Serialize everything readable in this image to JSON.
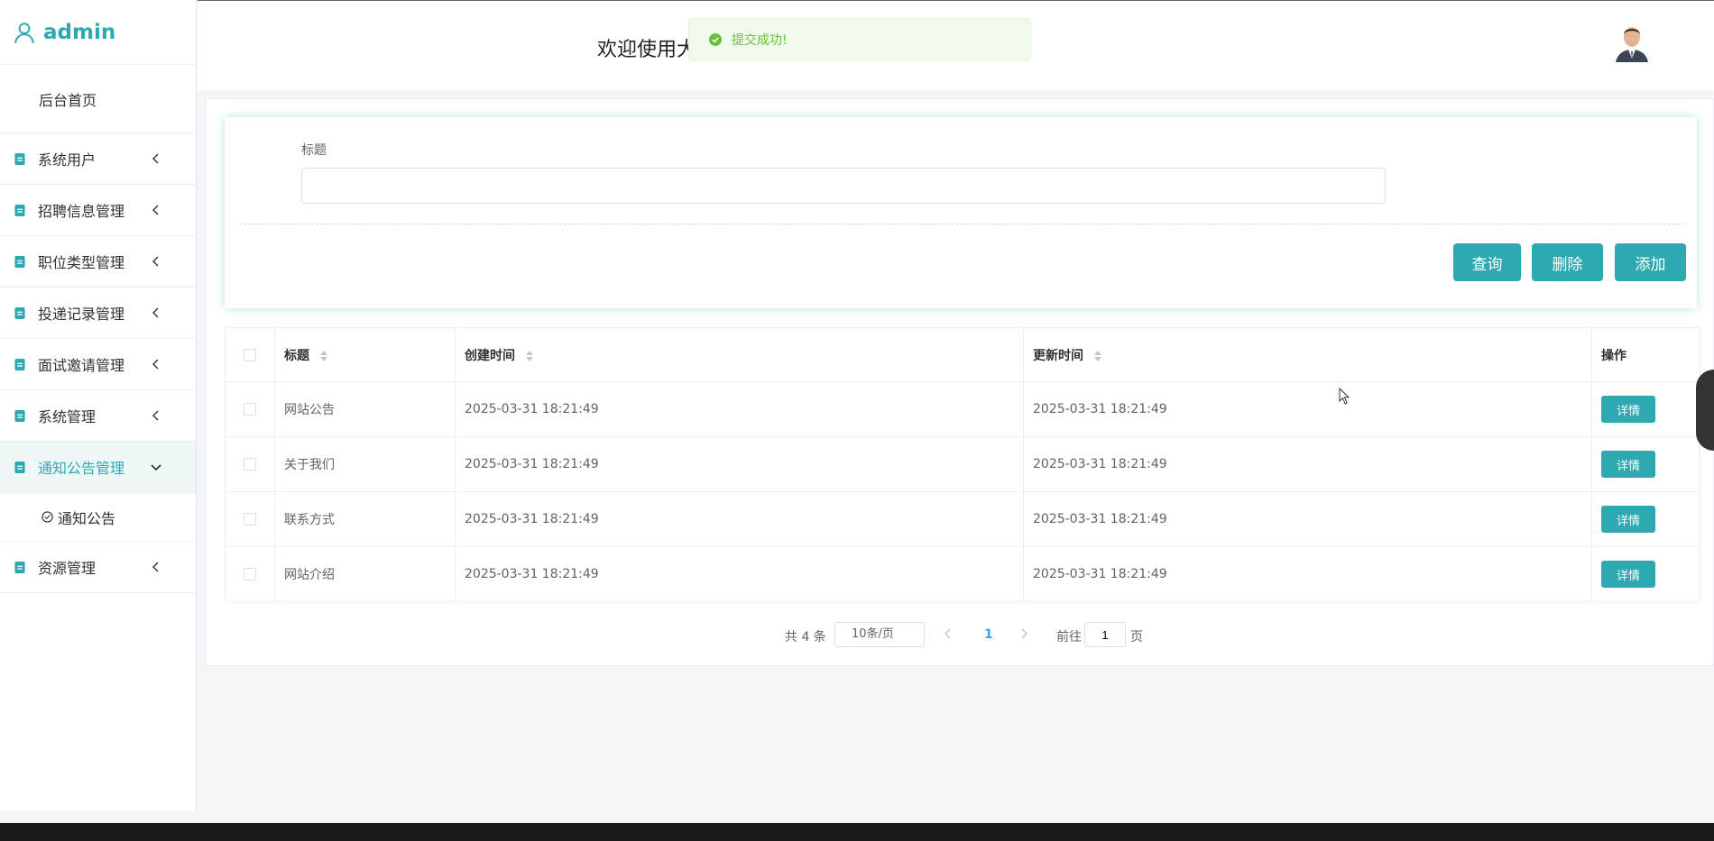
{
  "brand": {
    "name": "admin"
  },
  "sidebar": {
    "home": "后台首页",
    "items": [
      {
        "label": "系统用户"
      },
      {
        "label": "招聘信息管理"
      },
      {
        "label": "职位类型管理"
      },
      {
        "label": "投递记录管理"
      },
      {
        "label": "面试邀请管理"
      },
      {
        "label": "系统管理"
      },
      {
        "label": "通知公告管理",
        "active": true
      },
      {
        "label": "资源管理"
      }
    ],
    "submenu": {
      "label": "通知公告"
    }
  },
  "header": {
    "welcome": "欢迎使用大"
  },
  "toast": {
    "message": "提交成功!"
  },
  "search": {
    "label": "标题",
    "value": "",
    "buttons": {
      "query": "查询",
      "delete": "删除",
      "add": "添加"
    }
  },
  "table": {
    "headers": {
      "title": "标题",
      "created": "创建时间",
      "updated": "更新时间",
      "actions": "操作"
    },
    "rows": [
      {
        "title": "网站公告",
        "created": "2025-03-31 18:21:49",
        "updated": "2025-03-31 18:21:49",
        "action": "详情"
      },
      {
        "title": "关于我们",
        "created": "2025-03-31 18:21:49",
        "updated": "2025-03-31 18:21:49",
        "action": "详情"
      },
      {
        "title": "联系方式",
        "created": "2025-03-31 18:21:49",
        "updated": "2025-03-31 18:21:49",
        "action": "详情"
      },
      {
        "title": "网站介绍",
        "created": "2025-03-31 18:21:49",
        "updated": "2025-03-31 18:21:49",
        "action": "详情"
      }
    ]
  },
  "pagination": {
    "total": "共 4 条",
    "page_size": "10条/页",
    "current_page": "1",
    "goto_label": "前往",
    "goto_value": "1",
    "page_unit": "页"
  },
  "colors": {
    "accent": "#2fa9b1",
    "success": "#67c23a",
    "link": "#409eff"
  }
}
